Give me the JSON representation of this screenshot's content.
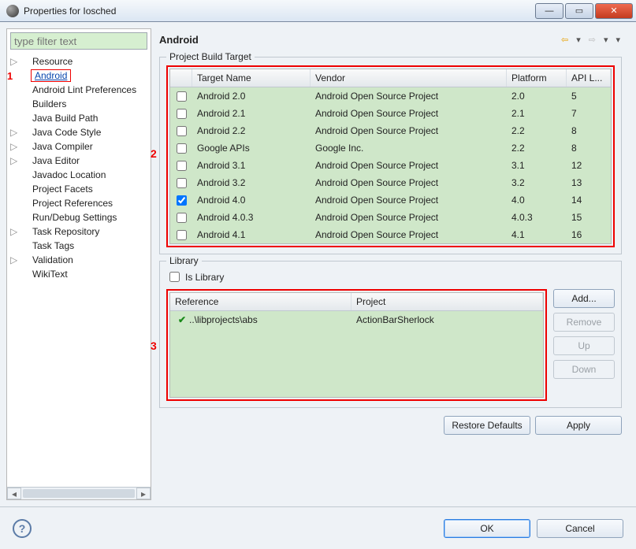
{
  "window": {
    "title": "Properties for Iosched"
  },
  "filter": {
    "placeholder": "type filter text"
  },
  "sidebar": {
    "items": [
      {
        "label": "Resource",
        "expandable": true
      },
      {
        "label": "Android",
        "selected": true,
        "annot": "1"
      },
      {
        "label": "Android Lint Preferences"
      },
      {
        "label": "Builders"
      },
      {
        "label": "Java Build Path"
      },
      {
        "label": "Java Code Style",
        "expandable": true
      },
      {
        "label": "Java Compiler",
        "expandable": true
      },
      {
        "label": "Java Editor",
        "expandable": true
      },
      {
        "label": "Javadoc Location"
      },
      {
        "label": "Project Facets"
      },
      {
        "label": "Project References"
      },
      {
        "label": "Run/Debug Settings"
      },
      {
        "label": "Task Repository",
        "expandable": true
      },
      {
        "label": "Task Tags"
      },
      {
        "label": "Validation",
        "expandable": true
      },
      {
        "label": "WikiText"
      }
    ]
  },
  "page": {
    "title": "Android",
    "group_build_target": "Project Build Target",
    "group_library": "Library",
    "is_library_label": "Is Library"
  },
  "targets": {
    "annot": "2",
    "headers": {
      "target": "Target Name",
      "vendor": "Vendor",
      "platform": "Platform",
      "api": "API L..."
    },
    "rows": [
      {
        "name": "Android 2.0",
        "vendor": "Android Open Source Project",
        "platform": "2.0",
        "api": "5",
        "checked": false
      },
      {
        "name": "Android 2.1",
        "vendor": "Android Open Source Project",
        "platform": "2.1",
        "api": "7",
        "checked": false
      },
      {
        "name": "Android 2.2",
        "vendor": "Android Open Source Project",
        "platform": "2.2",
        "api": "8",
        "checked": false
      },
      {
        "name": "Google APIs",
        "vendor": "Google Inc.",
        "platform": "2.2",
        "api": "8",
        "checked": false
      },
      {
        "name": "Android 3.1",
        "vendor": "Android Open Source Project",
        "platform": "3.1",
        "api": "12",
        "checked": false
      },
      {
        "name": "Android 3.2",
        "vendor": "Android Open Source Project",
        "platform": "3.2",
        "api": "13",
        "checked": false
      },
      {
        "name": "Android 4.0",
        "vendor": "Android Open Source Project",
        "platform": "4.0",
        "api": "14",
        "checked": true
      },
      {
        "name": "Android 4.0.3",
        "vendor": "Android Open Source Project",
        "platform": "4.0.3",
        "api": "15",
        "checked": false
      },
      {
        "name": "Android 4.1",
        "vendor": "Android Open Source Project",
        "platform": "4.1",
        "api": "16",
        "checked": false
      }
    ]
  },
  "library": {
    "annot": "3",
    "is_library_checked": false,
    "headers": {
      "reference": "Reference",
      "project": "Project"
    },
    "rows": [
      {
        "ref": "..\\libprojects\\abs",
        "project": "ActionBarSherlock",
        "ok": true
      }
    ],
    "buttons": {
      "add": "Add...",
      "remove": "Remove",
      "up": "Up",
      "down": "Down"
    }
  },
  "footer": {
    "restore": "Restore Defaults",
    "apply": "Apply",
    "ok": "OK",
    "cancel": "Cancel"
  }
}
